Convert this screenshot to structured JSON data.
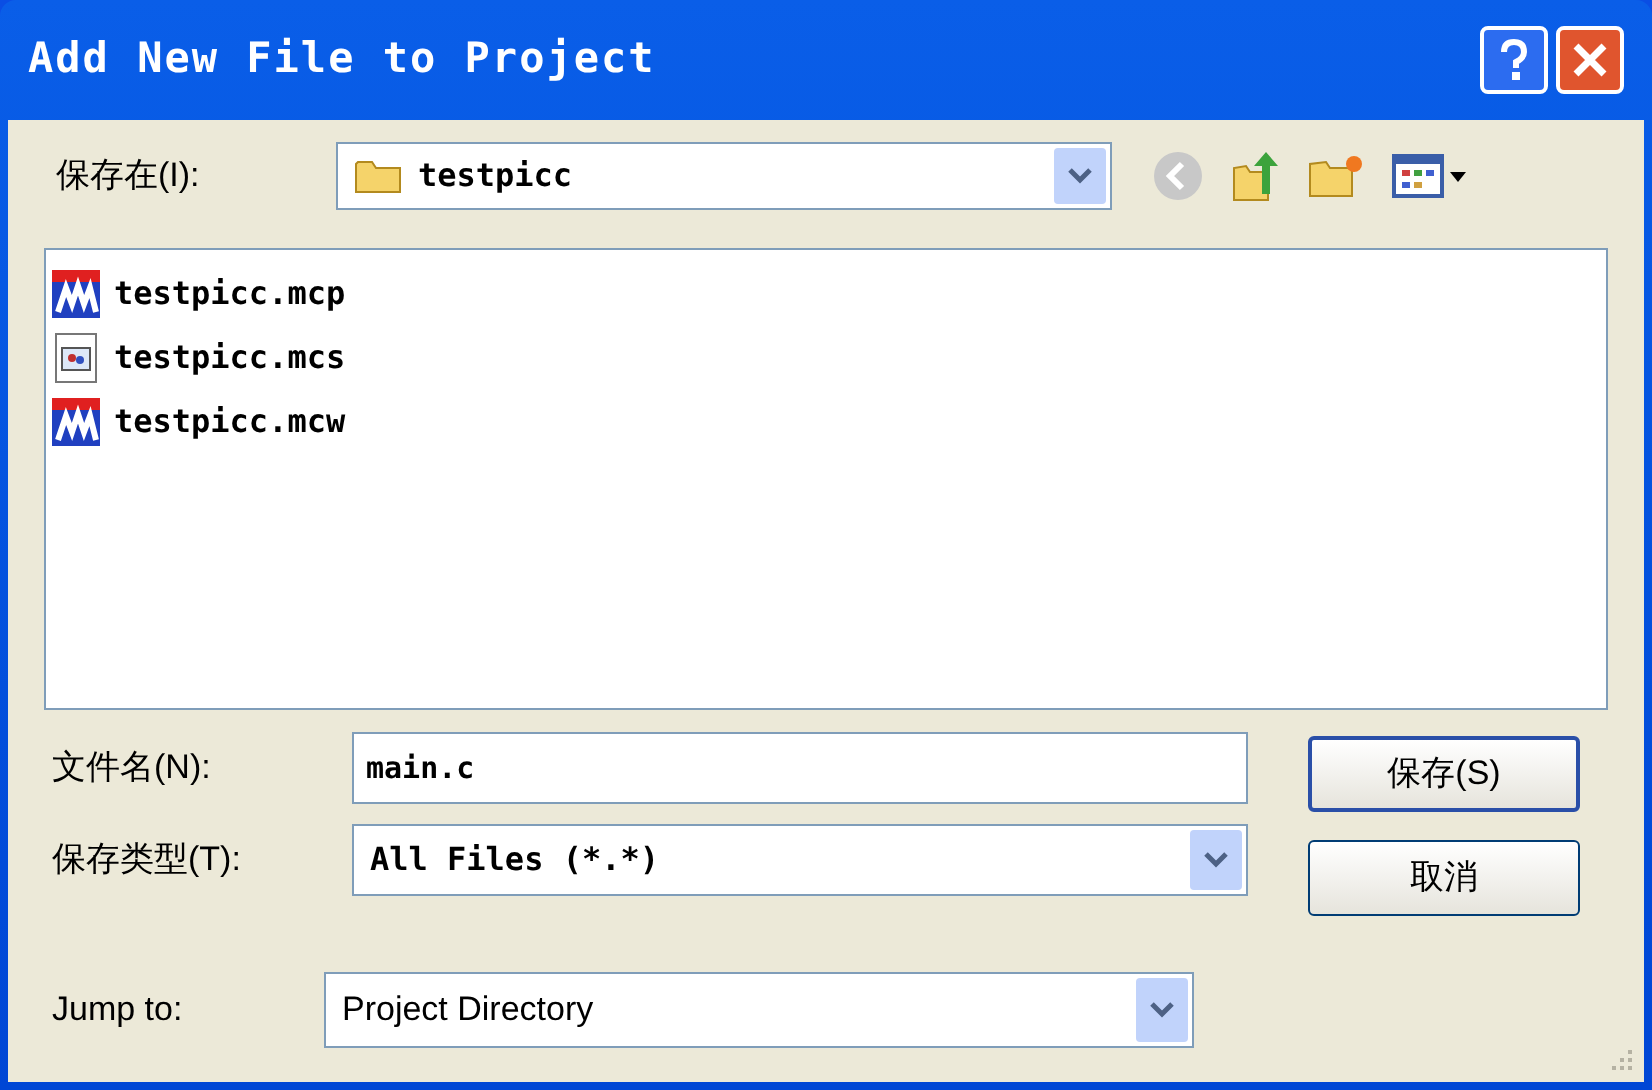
{
  "window": {
    "title": "Add New File to Project"
  },
  "save_in": {
    "label": "保存在(I):",
    "value": "testpicc"
  },
  "files": [
    {
      "name": "testpicc.mcp",
      "kind": "app"
    },
    {
      "name": "testpicc.mcs",
      "kind": "doc"
    },
    {
      "name": "testpicc.mcw",
      "kind": "app"
    }
  ],
  "file_name": {
    "label": "文件名(N):",
    "value": "main.c"
  },
  "save_type": {
    "label": "保存类型(T):",
    "value": "All Files (*.*)"
  },
  "buttons": [
    "保存(S)",
    "取消"
  ],
  "jump_to": {
    "label": "Jump to:",
    "value": "Project Directory"
  }
}
